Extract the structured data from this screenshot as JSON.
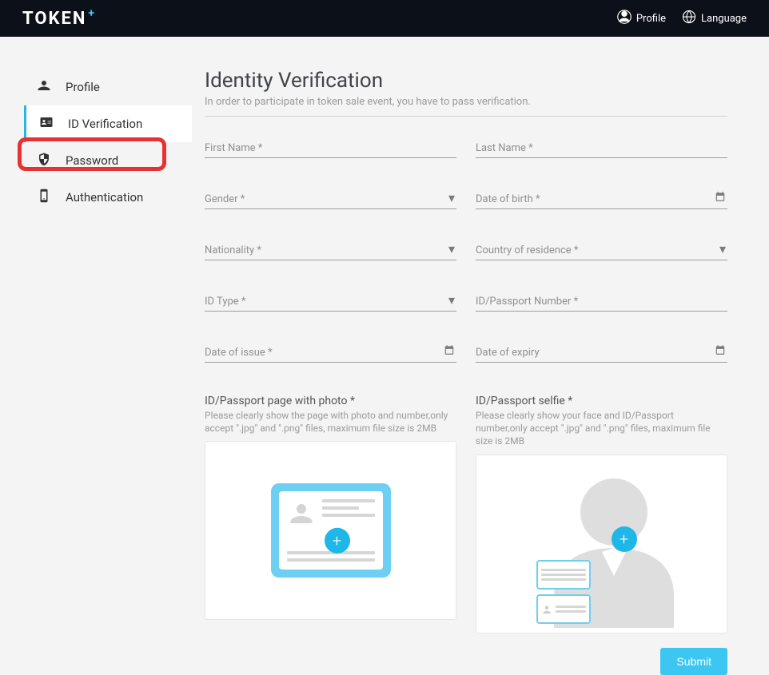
{
  "header": {
    "logo_text": "TOKEN",
    "logo_plus": "+",
    "profile_label": "Profile",
    "language_label": "Language"
  },
  "sidebar": {
    "items": [
      {
        "label": "Profile",
        "active": false
      },
      {
        "label": "ID Verification",
        "active": true
      },
      {
        "label": "Password",
        "active": false
      },
      {
        "label": "Authentication",
        "active": false
      }
    ]
  },
  "page": {
    "title": "Identity Verification",
    "subtitle": "In order to participate in token sale event, you have to pass verification."
  },
  "form": {
    "first_name": "First Name *",
    "last_name": "Last Name *",
    "gender": "Gender *",
    "dob": "Date of birth *",
    "nationality": "Nationality *",
    "country_residence": "Country of residence *",
    "id_type": "ID Type *",
    "id_number": "ID/Passport Number *",
    "date_issue": "Date of issue *",
    "date_expiry": "Date of expiry"
  },
  "uploads": {
    "photo_title": "ID/Passport page with photo *",
    "photo_desc": "Please clearly show the page with photo and number,only accept \".jpg\" and \".png\" files, maximum file size is 2MB",
    "selfie_title": "ID/Passport selfie *",
    "selfie_desc": "Please clearly show your face and ID/Passport number,only accept \".jpg\" and \".png\" files, maximum file size is 2MB"
  },
  "buttons": {
    "submit": "Submit"
  }
}
